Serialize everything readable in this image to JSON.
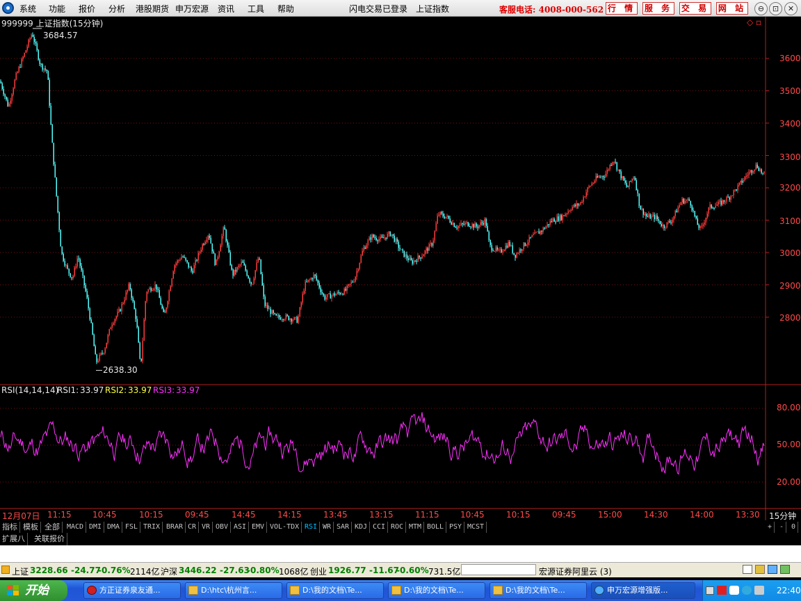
{
  "menubar": {
    "items": [
      "系统",
      "功能",
      "报价",
      "分析",
      "港股期货",
      "申万宏源",
      "资讯",
      "工具",
      "帮助"
    ],
    "login_status": "闪电交易已登录",
    "current_index": "上证指数",
    "hotline": "客服电话: 4008-000-562",
    "buttons": [
      "行 情",
      "服 务",
      "交 易",
      "网 站"
    ],
    "window_controls": [
      "⊖",
      "⊡",
      "✕"
    ]
  },
  "main_chart": {
    "title": "999999 上证指数(15分钟)",
    "high_label": "3684.57",
    "low_label": "2638.30",
    "y_ticks": [
      "3600",
      "3500",
      "3400",
      "3300",
      "3200",
      "3100",
      "3000",
      "2900",
      "2800"
    ],
    "colors": {
      "up": "#ff3c3c",
      "down": "#54ffff",
      "axis": "#b02020",
      "grid": "#7a1010"
    }
  },
  "rsi_panel": {
    "title": "RSI(14,14,14)",
    "rsi1_label": "RSI1:",
    "rsi1_value": "33.97",
    "rsi2_label": "RSI2:",
    "rsi2_value": "33.97",
    "rsi3_label": "RSI3:",
    "rsi3_value": "33.97",
    "y_ticks": [
      "80.00",
      "50.00",
      "20.00"
    ],
    "line_color": "#ff30ff"
  },
  "time_axis": {
    "labels": [
      "12月07日",
      "11:15",
      "10:45",
      "10:15",
      "09:45",
      "14:45",
      "14:15",
      "13:45",
      "13:15",
      "11:15",
      "10:45",
      "10:15",
      "09:45",
      "15:00",
      "14:30",
      "14:00",
      "13:30"
    ],
    "period": "15分钟"
  },
  "indicator_tabs": [
    "指标",
    "模板",
    "全部",
    "MACD",
    "DMI",
    "DMA",
    "FSL",
    "TRIX",
    "BRAR",
    "CR",
    "VR",
    "OBV",
    "ASI",
    "EMV",
    "VOL-TDX",
    "RSI",
    "WR",
    "SAR",
    "KDJ",
    "CCI",
    "ROC",
    "MTM",
    "BOLL",
    "PSY",
    "MCST"
  ],
  "indicator_selected": "RSI",
  "zoom_controls": [
    "+",
    "-",
    "0"
  ],
  "bottom_tabs": [
    "扩展八",
    "关联报价"
  ],
  "status": {
    "sh_name": "上证",
    "sh_value": "3228.66",
    "sh_change": "-24.77",
    "sh_pct": "-0.76%",
    "sh_amount": "2114亿",
    "hs_name": "沪深",
    "hs_value": "3446.22",
    "hs_change": "-27.63",
    "hs_pct": "-0.80%",
    "hs_amount": "1068亿",
    "cy_name": "创业",
    "cy_value": "1926.77",
    "cy_change": "-11.67",
    "cy_pct": "-0.60%",
    "cy_amount": "731.5亿",
    "server": "宏源证券阿里云 (3)"
  },
  "taskbar": {
    "start": "开始",
    "items": [
      "方正证券泉友通...",
      "D:\\htc\\杭州言...",
      "D:\\我的文档\\Te...",
      "D:\\我的文档\\Te...",
      "D:\\我的文档\\Te...",
      "申万宏源增强版..."
    ],
    "clock": "22:40"
  }
}
